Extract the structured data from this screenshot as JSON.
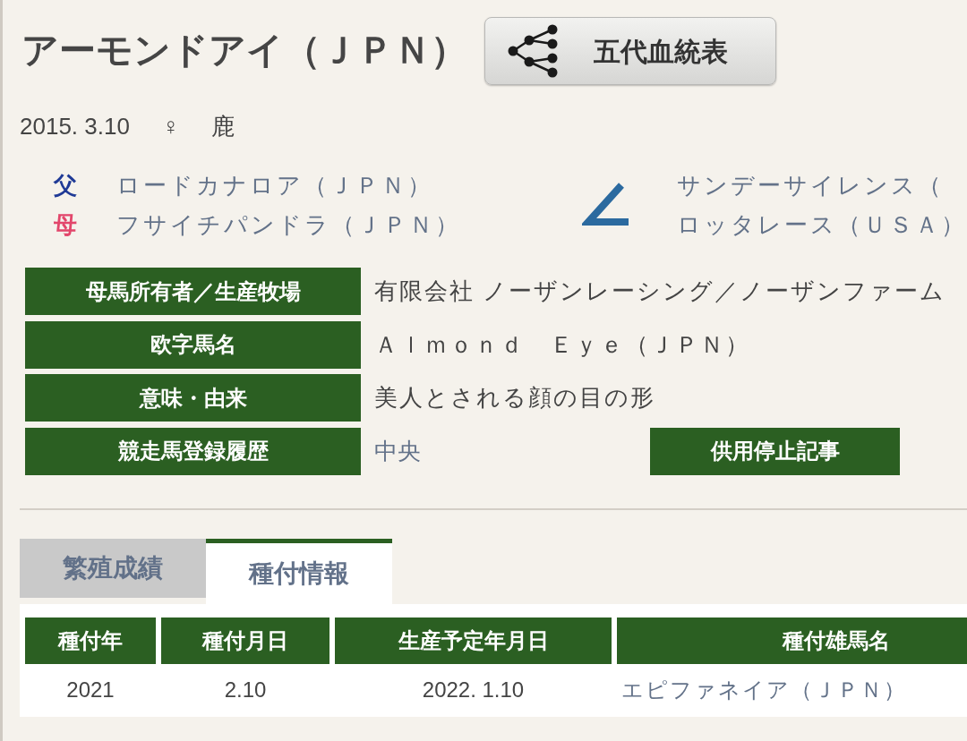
{
  "title": "アーモンドアイ（ＪＰＮ）",
  "pedigree_button": "五代血統表",
  "profile": {
    "birth_date": "2015. 3.10",
    "sex": "♀",
    "coat": "鹿"
  },
  "parents": [
    {
      "role": "父",
      "name": "ロードカナロア（ＪＰＮ）",
      "color": "#1f3a96"
    },
    {
      "role": "母",
      "name": "フサイチパンドラ（ＪＰＮ）",
      "color": "#e2466b"
    }
  ],
  "dam_parents": [
    "サンデーサイレンス（",
    "ロッタレース（ＵＳＡ）"
  ],
  "info_rows": [
    {
      "label": "母馬所有者／生産牧場",
      "value": "有限会社 ノーザンレーシング／ノーザンファーム",
      "kind": "text"
    },
    {
      "label": "欧字馬名",
      "value": "Ａｌｍｏｎｄ　Ｅｙｅ（ＪＰＮ）",
      "kind": "text"
    },
    {
      "label": "意味・由来",
      "value": "美人とされる顔の目の形",
      "kind": "text"
    },
    {
      "label": "競走馬登録履歴",
      "value": "中央",
      "kind": "link",
      "button": "供用停止記事"
    }
  ],
  "tabs": [
    {
      "label": "繁殖成績",
      "selected": false
    },
    {
      "label": "種付情報",
      "selected": true
    }
  ],
  "table": {
    "columns": [
      {
        "label": "種付年",
        "kind": "text"
      },
      {
        "label": "種付月日",
        "kind": "text"
      },
      {
        "label": "生産予定年月日",
        "kind": "text"
      },
      {
        "label": "種付雄馬名",
        "kind": "link"
      }
    ],
    "rows": [
      [
        "2021",
        "2.10",
        "2022. 1.10",
        "エピファネイア（ＪＰＮ）"
      ]
    ]
  }
}
